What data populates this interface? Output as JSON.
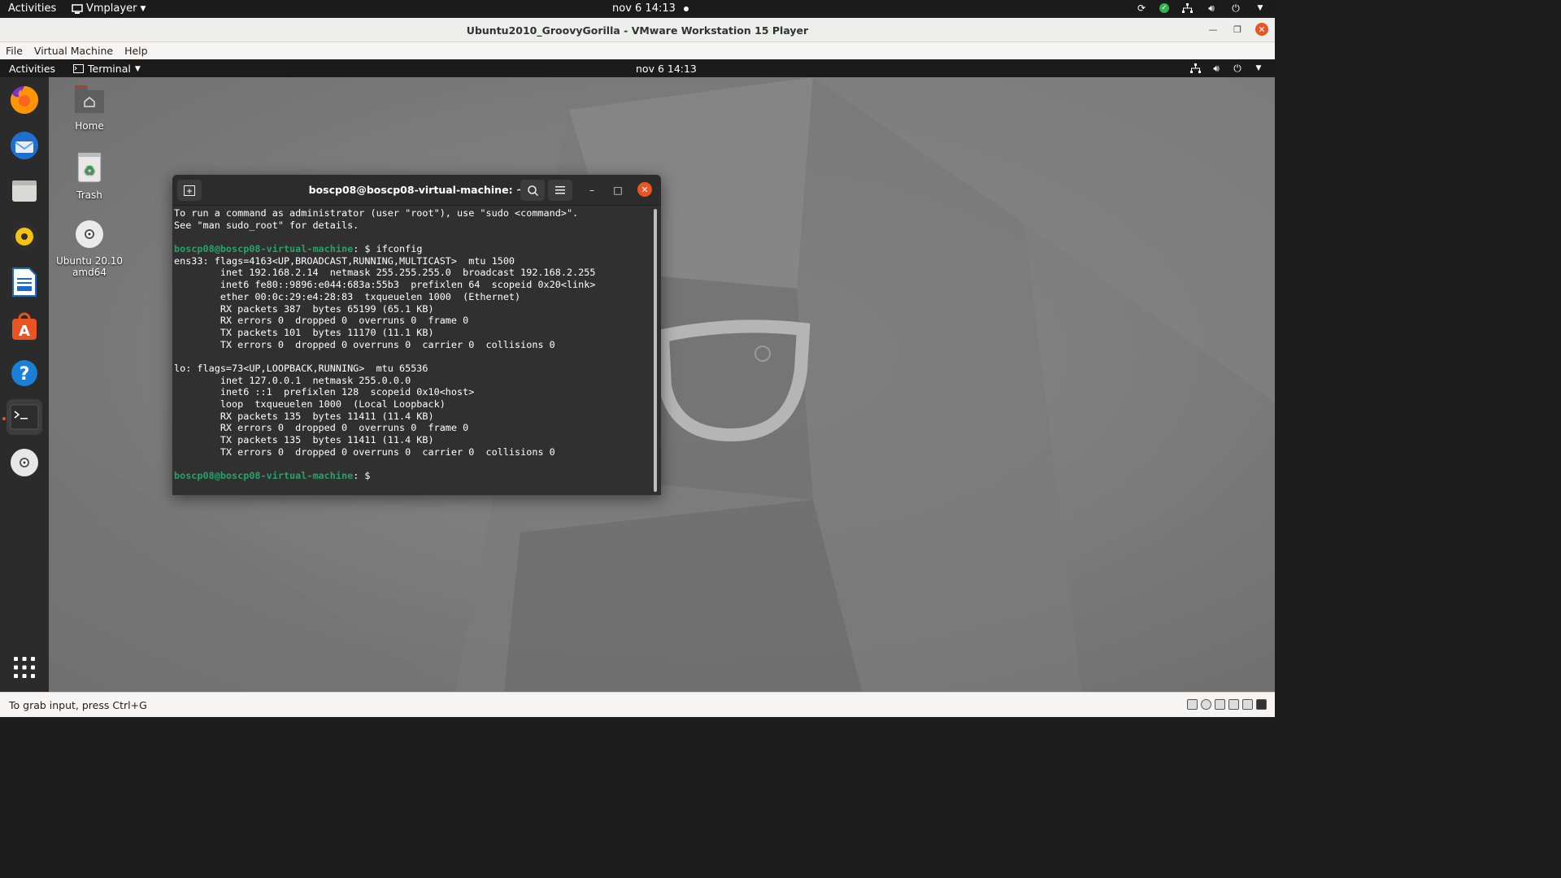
{
  "host_bar": {
    "activities": "Activities",
    "app_menu": "Vmplayer",
    "clock": "nov 6  14:13"
  },
  "vm_window": {
    "title": "Ubuntu2010_GroovyGorilla - VMware Workstation 15 Player",
    "menu": [
      "File",
      "Virtual Machine",
      "Help"
    ]
  },
  "guest_bar": {
    "activities": "Activities",
    "app_menu": "Terminal",
    "clock": "nov 6  14:13"
  },
  "dock": {
    "items": [
      {
        "name": "firefox-icon",
        "running": false
      },
      {
        "name": "thunderbird-icon",
        "running": false
      },
      {
        "name": "files-icon",
        "running": false
      },
      {
        "name": "rhythmbox-icon",
        "running": false
      },
      {
        "name": "libreoffice-writer-icon",
        "running": false
      },
      {
        "name": "software-center-icon",
        "running": false
      },
      {
        "name": "help-icon",
        "running": false
      },
      {
        "name": "terminal-icon",
        "running": true
      },
      {
        "name": "dvd-icon",
        "running": false
      }
    ],
    "apps_grid": "show-applications-icon"
  },
  "desktop": {
    "icons": [
      {
        "label": "Home",
        "icon": "home-folder-icon"
      },
      {
        "label": "Trash",
        "icon": "trash-icon"
      },
      {
        "label": "Ubuntu 20.10\namd64",
        "icon": "disc-icon"
      }
    ]
  },
  "terminal": {
    "title": "boscp08@boscp08-virtual-machine: ~",
    "prompt_user": "boscp08@boscp08-virtual-machine",
    "prompt_path": ": $ ",
    "lines": [
      {
        "type": "text",
        "text": "To run a command as administrator (user \"root\"), use \"sudo <command>\"."
      },
      {
        "type": "text",
        "text": "See \"man sudo_root\" for details."
      },
      {
        "type": "text",
        "text": ""
      },
      {
        "type": "prompt",
        "text": "ifconfig"
      },
      {
        "type": "text",
        "text": "ens33: flags=4163<UP,BROADCAST,RUNNING,MULTICAST>  mtu 1500"
      },
      {
        "type": "text",
        "text": "        inet 192.168.2.14  netmask 255.255.255.0  broadcast 192.168.2.255"
      },
      {
        "type": "text",
        "text": "        inet6 fe80::9896:e044:683a:55b3  prefixlen 64  scopeid 0x20<link>"
      },
      {
        "type": "text",
        "text": "        ether 00:0c:29:e4:28:83  txqueuelen 1000  (Ethernet)"
      },
      {
        "type": "text",
        "text": "        RX packets 387  bytes 65199 (65.1 KB)"
      },
      {
        "type": "text",
        "text": "        RX errors 0  dropped 0  overruns 0  frame 0"
      },
      {
        "type": "text",
        "text": "        TX packets 101  bytes 11170 (11.1 KB)"
      },
      {
        "type": "text",
        "text": "        TX errors 0  dropped 0 overruns 0  carrier 0  collisions 0"
      },
      {
        "type": "text",
        "text": ""
      },
      {
        "type": "text",
        "text": "lo: flags=73<UP,LOOPBACK,RUNNING>  mtu 65536"
      },
      {
        "type": "text",
        "text": "        inet 127.0.0.1  netmask 255.0.0.0"
      },
      {
        "type": "text",
        "text": "        inet6 ::1  prefixlen 128  scopeid 0x10<host>"
      },
      {
        "type": "text",
        "text": "        loop  txqueuelen 1000  (Local Loopback)"
      },
      {
        "type": "text",
        "text": "        RX packets 135  bytes 11411 (11.4 KB)"
      },
      {
        "type": "text",
        "text": "        RX errors 0  dropped 0  overruns 0  frame 0"
      },
      {
        "type": "text",
        "text": "        TX packets 135  bytes 11411 (11.4 KB)"
      },
      {
        "type": "text",
        "text": "        TX errors 0  dropped 0 overruns 0  carrier 0  collisions 0"
      },
      {
        "type": "text",
        "text": ""
      },
      {
        "type": "prompt",
        "text": ""
      }
    ]
  },
  "statusbar": {
    "message": "To grab input, press Ctrl+G"
  },
  "colors": {
    "accent": "#e95420",
    "prompt": "#26a269",
    "terminal_bg": "#303030"
  }
}
